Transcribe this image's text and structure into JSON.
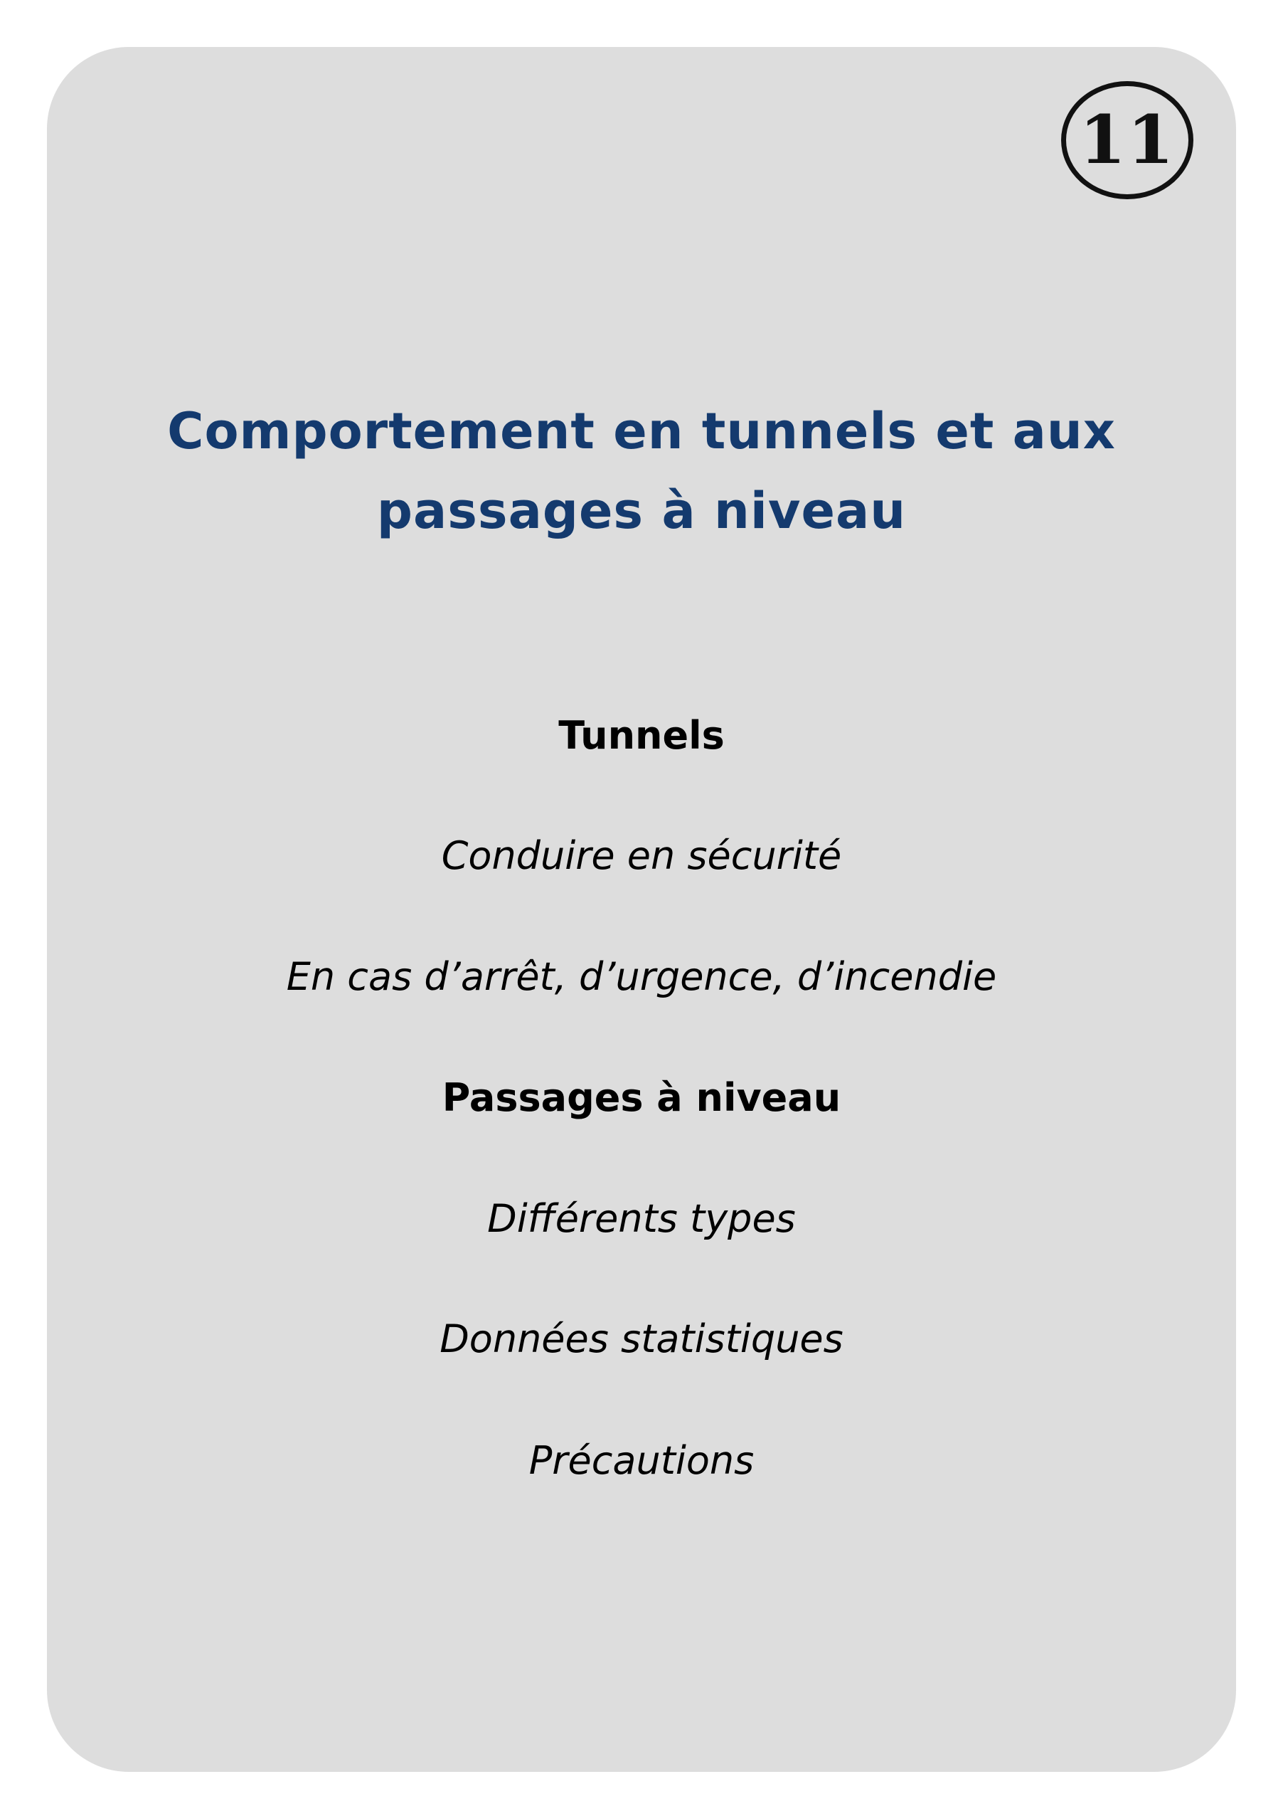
{
  "card": {
    "number": "11",
    "title_line1": "Comportement en tunnels et aux",
    "title_line2": "passages à niveau",
    "items": [
      {
        "text": "Tunnels",
        "style": "heading"
      },
      {
        "text": "Conduire en sécurité",
        "style": "italic"
      },
      {
        "text": "En cas d’arrêt, d’urgence, d’incendie",
        "style": "italic"
      },
      {
        "text": "Passages à niveau",
        "style": "heading"
      },
      {
        "text": "Différents types",
        "style": "italic"
      },
      {
        "text": "Données statistiques",
        "style": "italic"
      },
      {
        "text": "Précautions",
        "style": "italic"
      }
    ],
    "colors": {
      "background": "#dddddd",
      "title": "#143a6e",
      "text": "#000000"
    }
  }
}
